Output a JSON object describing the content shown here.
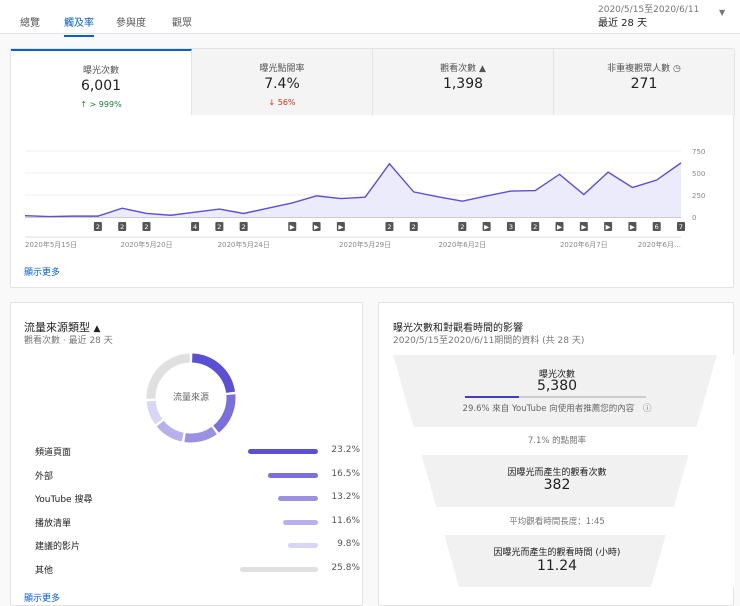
{
  "tabs": [
    "總覽",
    "觸及率",
    "參與度",
    "觀眾"
  ],
  "active_tab": 1,
  "date_range": {
    "range": "2020/5/15至2020/6/11",
    "label": "最近 28 天"
  },
  "metrics": [
    {
      "label": "曝光次數",
      "value": "6,001",
      "delta": "↑ > 999%",
      "delta_color": "#188038"
    },
    {
      "label": "曝光點閱率",
      "value": "7.4%",
      "delta": "↓ 56%",
      "delta_color": "#d93025"
    },
    {
      "label": "觀看次數 ▲",
      "value": "1,398",
      "delta": ""
    },
    {
      "label": "非重複觀眾人數 ◷",
      "value": "271",
      "delta": ""
    }
  ],
  "chart_data": {
    "type": "line",
    "series": [
      {
        "name": "曝光次數",
        "values": [
          15,
          5,
          10,
          10,
          100,
          40,
          20,
          55,
          90,
          40,
          100,
          160,
          240,
          210,
          225,
          605,
          285,
          230,
          180,
          240,
          295,
          300,
          485,
          255,
          510,
          335,
          420,
          615
        ]
      }
    ],
    "y_ticks": [
      "750",
      "500",
      "250",
      "0"
    ],
    "ylim": [
      0,
      750
    ],
    "x_labels": [
      {
        "i": 0,
        "t": "2020年5月15日"
      },
      {
        "i": 5,
        "t": "2020年5月20日"
      },
      {
        "i": 9,
        "t": "2020年5月24日"
      },
      {
        "i": 14,
        "t": "2020年5月29日"
      },
      {
        "i": 18,
        "t": "2020年6月2日"
      },
      {
        "i": 23,
        "t": "2020年6月7日"
      },
      {
        "i": 27,
        "t": "2020年6月…"
      }
    ],
    "markers": [
      {
        "i": 3,
        "t": "2"
      },
      {
        "i": 4,
        "t": "2"
      },
      {
        "i": 5,
        "t": "2"
      },
      {
        "i": 7,
        "t": "4"
      },
      {
        "i": 8,
        "t": "2"
      },
      {
        "i": 9,
        "t": "2"
      },
      {
        "i": 11,
        "t": "▶"
      },
      {
        "i": 12,
        "t": "▶"
      },
      {
        "i": 13,
        "t": "▶"
      },
      {
        "i": 15,
        "t": "2"
      },
      {
        "i": 16,
        "t": "2"
      },
      {
        "i": 18,
        "t": "2"
      },
      {
        "i": 19,
        "t": "▶"
      },
      {
        "i": 20,
        "t": "3"
      },
      {
        "i": 21,
        "t": "2"
      },
      {
        "i": 22,
        "t": "▶"
      },
      {
        "i": 23,
        "t": "▶"
      },
      {
        "i": 24,
        "t": "▶"
      },
      {
        "i": 25,
        "t": "▶"
      },
      {
        "i": 26,
        "t": "6"
      },
      {
        "i": 27,
        "t": "7"
      }
    ]
  },
  "show_more": "顯示更多",
  "traffic": {
    "title": "流量來源類型",
    "subtitle": "觀看次數 · 最近 28 天",
    "donut_label": "流量來源",
    "items": [
      {
        "label": "頻道頁面",
        "pct": "23.2%",
        "value": 23.2,
        "color": "#5b4fd6"
      },
      {
        "label": "外部",
        "pct": "16.5%",
        "value": 16.5,
        "color": "#7a6fdc"
      },
      {
        "label": "YouTube 搜尋",
        "pct": "13.2%",
        "value": 13.2,
        "color": "#9a91e3"
      },
      {
        "label": "播放清單",
        "pct": "11.6%",
        "value": 11.6,
        "color": "#b7b0ec"
      },
      {
        "label": "建議的影片",
        "pct": "9.8%",
        "value": 9.8,
        "color": "#d8d5f5"
      },
      {
        "label": "其他",
        "pct": "25.8%",
        "value": 25.8,
        "color": "#e0e0e0"
      }
    ]
  },
  "funnel": {
    "title": "曝光次數和對觀看時間的影響",
    "subtitle": "2020/5/15至2020/6/11期間的資料 (共 28 天)",
    "impressions_label": "曝光次數",
    "impressions": "5,380",
    "recommend_fraction": 0.296,
    "recommend_text": "29.6% 來自 YouTube 向使用者推薦您的內容",
    "ctr_text": "7.1% 的點閱率",
    "views_label": "因曝光而產生的觀看次數",
    "views": "382",
    "avg_text": "平均觀看時間長度：1:45",
    "watch_label": "因曝光而產生的觀看時間 (小時)",
    "watch": "11.24"
  }
}
